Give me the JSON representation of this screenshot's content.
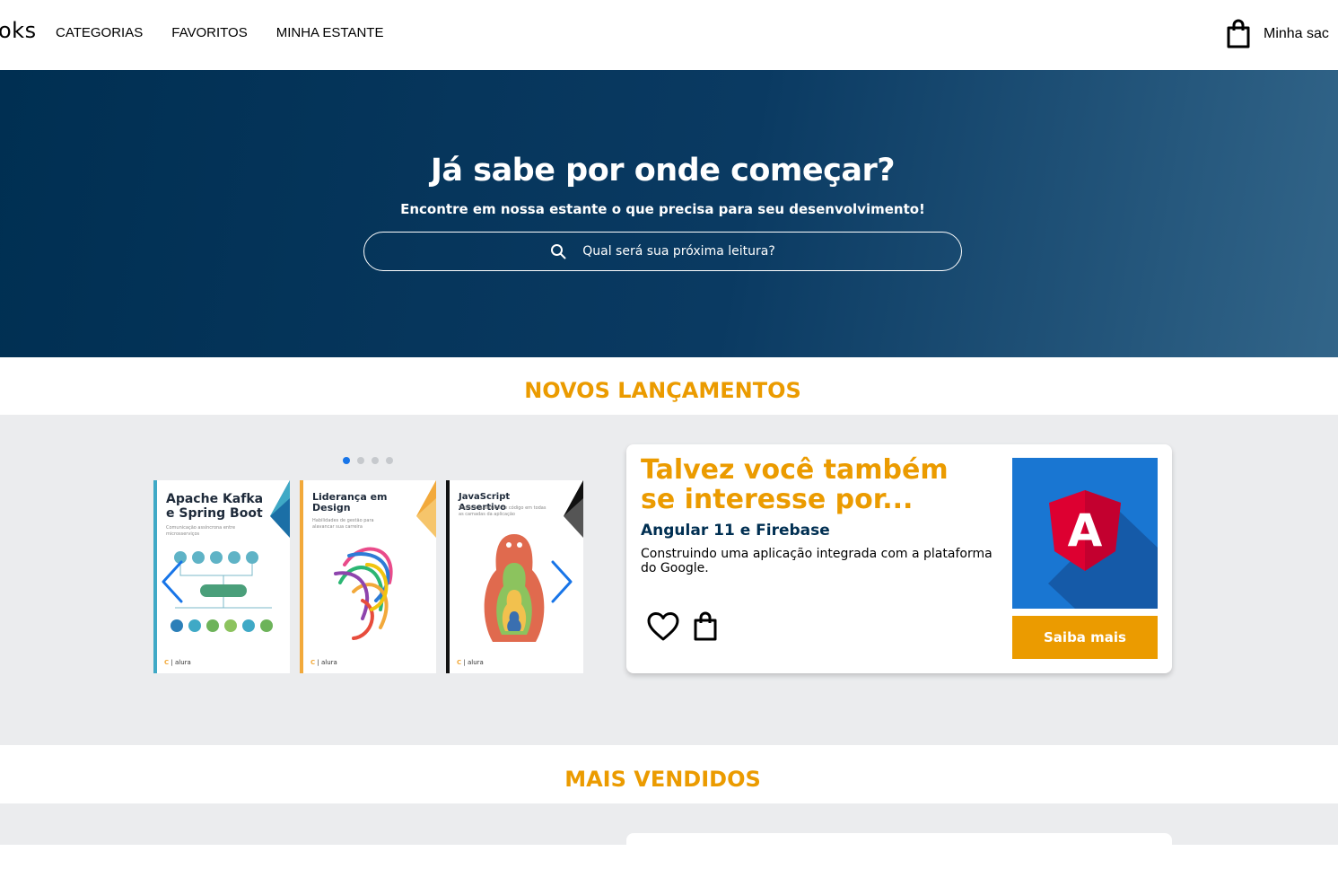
{
  "header": {
    "logo": "oks",
    "nav": [
      "CATEGORIAS",
      "FAVORITOS",
      "MINHA ESTANTE"
    ],
    "bag_label": "Minha sac"
  },
  "hero": {
    "title": "Já sabe por onde começar?",
    "subtitle": "Encontre em nossa estante o que precisa para seu desenvolvimento!",
    "search_placeholder": "Qual será sua próxima leitura?"
  },
  "sections": {
    "new_releases": "NOVOS LANÇAMENTOS",
    "best_sellers": "MAIS VENDIDOS"
  },
  "carousel": {
    "dots": 4,
    "active_dot": 0,
    "books": [
      {
        "title": "Apache Kafka e Spring Boot",
        "subtitle": "Comunicação assíncrona entre microsserviços",
        "footer": "alura",
        "accent": "#3fa9c6"
      },
      {
        "title": "Liderança em Design",
        "subtitle": "Habilidades de gestão para alavancar sua carreira",
        "footer": "alura",
        "accent": "#f2a93b"
      },
      {
        "title": "JavaScript Assertivo",
        "subtitle": "Testes e qualidade de código em todas as camadas da aplicação",
        "footer": "alura",
        "accent": "#111111"
      }
    ]
  },
  "suggestion": {
    "heading": "Talvez você também se interesse por...",
    "book_title": "Angular 11 e Firebase",
    "description": "Construindo uma aplicação integrada com a plataforma do Google.",
    "cta": "Saiba mais",
    "cover_letter": "A"
  },
  "colors": {
    "accent": "#eb9b00",
    "navy": "#002f52",
    "band": "#ebecee",
    "carousel_blue": "#1875e8"
  },
  "icons": [
    "bag-icon",
    "search-icon",
    "heart-icon",
    "chevron-left-icon",
    "chevron-right-icon"
  ]
}
